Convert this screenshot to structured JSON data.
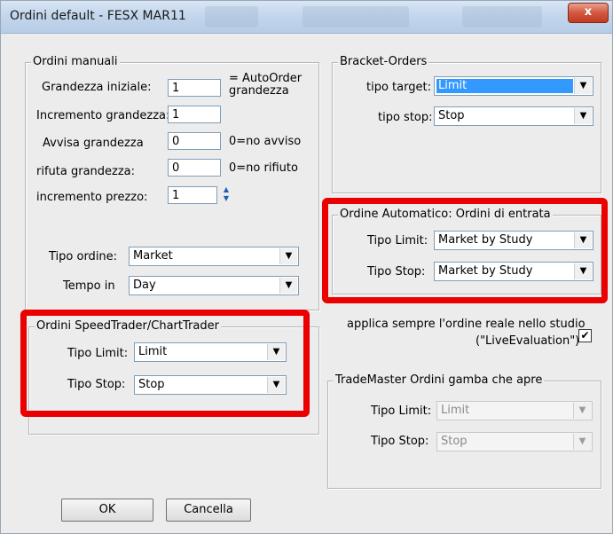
{
  "window": {
    "title": "Ordini default - FESX MAR11",
    "close_glyph": "x"
  },
  "manual": {
    "title": "Ordini manuali",
    "rows": [
      {
        "label": "Grandezza iniziale:",
        "value": "1",
        "note": "= AutoOrder\ngrandezza"
      },
      {
        "label": "Incremento grandezza:",
        "value": "1",
        "note": ""
      },
      {
        "label": "Avvisa grandezza",
        "value": "0",
        "note": "0=no avviso"
      },
      {
        "label": "rifuta grandezza:",
        "value": "0",
        "note": "0=no rifiuto"
      },
      {
        "label": "incremento prezzo:",
        "value": "1",
        "note": ""
      }
    ],
    "tipo_ordine": {
      "label": "Tipo ordine:",
      "value": "Market"
    },
    "tempo_in": {
      "label": "Tempo in",
      "value": "Day"
    }
  },
  "speedtrader": {
    "title": "Ordini SpeedTrader/ChartTrader",
    "limit": {
      "label": "Tipo Limit:",
      "value": "Limit"
    },
    "stop": {
      "label": "Tipo Stop:",
      "value": "Stop"
    }
  },
  "bracket": {
    "title": "Bracket-Orders",
    "target": {
      "label": "tipo target:",
      "value": "Limit"
    },
    "stop": {
      "label": "tipo stop:",
      "value": "Stop"
    }
  },
  "automatic": {
    "title": "Ordine Automatico: Ordini di entrata",
    "limit": {
      "label": "Tipo Limit:",
      "value": "Market by Study"
    },
    "stop": {
      "label": "Tipo Stop:",
      "value": "Market by Study"
    }
  },
  "live_eval": {
    "line1": "applica sempre  l'ordine reale nello studio",
    "line2": "(\"LiveEvaluation\")",
    "checked": true
  },
  "trademaster": {
    "title": "TradeMaster Ordini gamba che apre",
    "limit": {
      "label": "Tipo Limit:",
      "value": "Limit"
    },
    "stop": {
      "label": "Tipo Stop:",
      "value": "Stop"
    }
  },
  "buttons": {
    "ok": "OK",
    "cancel": "Cancella"
  },
  "colors": {
    "highlight": "#ea0000",
    "selection": "#3399ff"
  }
}
